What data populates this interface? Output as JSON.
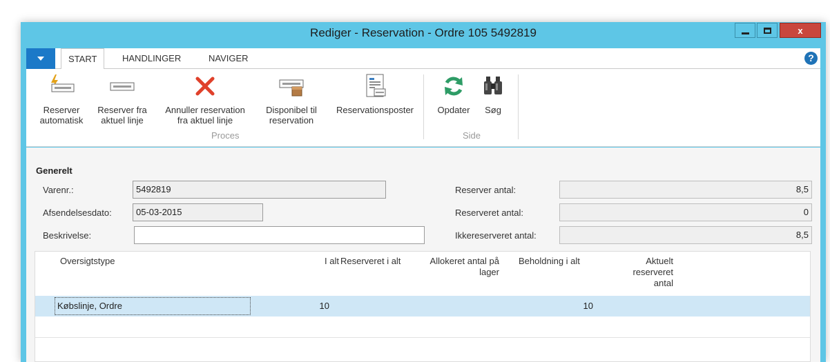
{
  "window": {
    "title": "Rediger - Reservation - Ordre 105 5492819",
    "close_label": "x"
  },
  "tabs": [
    {
      "label": "START",
      "active": true
    },
    {
      "label": "HANDLINGER",
      "active": false
    },
    {
      "label": "NAVIGER",
      "active": false
    }
  ],
  "help_label": "?",
  "ribbon": {
    "reserve_auto": {
      "line1": "Reserver",
      "line2": "automatisk"
    },
    "reserve_line": {
      "line1": "Reserver fra",
      "line2": "aktuel linje"
    },
    "cancel_reservation": {
      "line1": "Annuller reservation",
      "line2": "fra aktuel linje"
    },
    "available": {
      "line1": "Disponibel til",
      "line2": "reservation"
    },
    "entries": {
      "line1": "Reservationsposter"
    },
    "update": {
      "line1": "Opdater"
    },
    "search": {
      "line1": "Søg"
    },
    "group_proces": "Proces",
    "group_side": "Side"
  },
  "general": {
    "title": "Generelt",
    "item_no_label": "Varenr.:",
    "item_no_value": "5492819",
    "ship_date_label": "Afsendelsesdato:",
    "ship_date_value": "05-03-2015",
    "description_label": "Beskrivelse:",
    "description_value": "",
    "reserve_qty_label": "Reserver antal:",
    "reserve_qty_value": "8,5",
    "reserved_qty_label": "Reserveret antal:",
    "reserved_qty_value": "0",
    "unreserved_qty_label": "Ikkereserveret antal:",
    "unreserved_qty_value": "8,5"
  },
  "grid": {
    "headers": {
      "type": "Oversigtstype",
      "total": "I alt",
      "reserved_total": "Reserveret i alt",
      "allocated_line1": "Allokeret antal på",
      "allocated_line2": "lager",
      "inventory_total": "Beholdning i alt",
      "current_line1": "Aktuelt",
      "current_line2": "reserveret",
      "current_line3": "antal"
    },
    "rows": [
      {
        "type": "Købslinje, Ordre",
        "total": "10",
        "reserved_total": "",
        "allocated": "",
        "inventory_total": "10",
        "current": ""
      }
    ]
  },
  "colors": {
    "titlebar": "#5ec6e6",
    "appmenu": "#1b79c8",
    "selected_row": "#cfe7f6",
    "close_button": "#c9463d"
  }
}
